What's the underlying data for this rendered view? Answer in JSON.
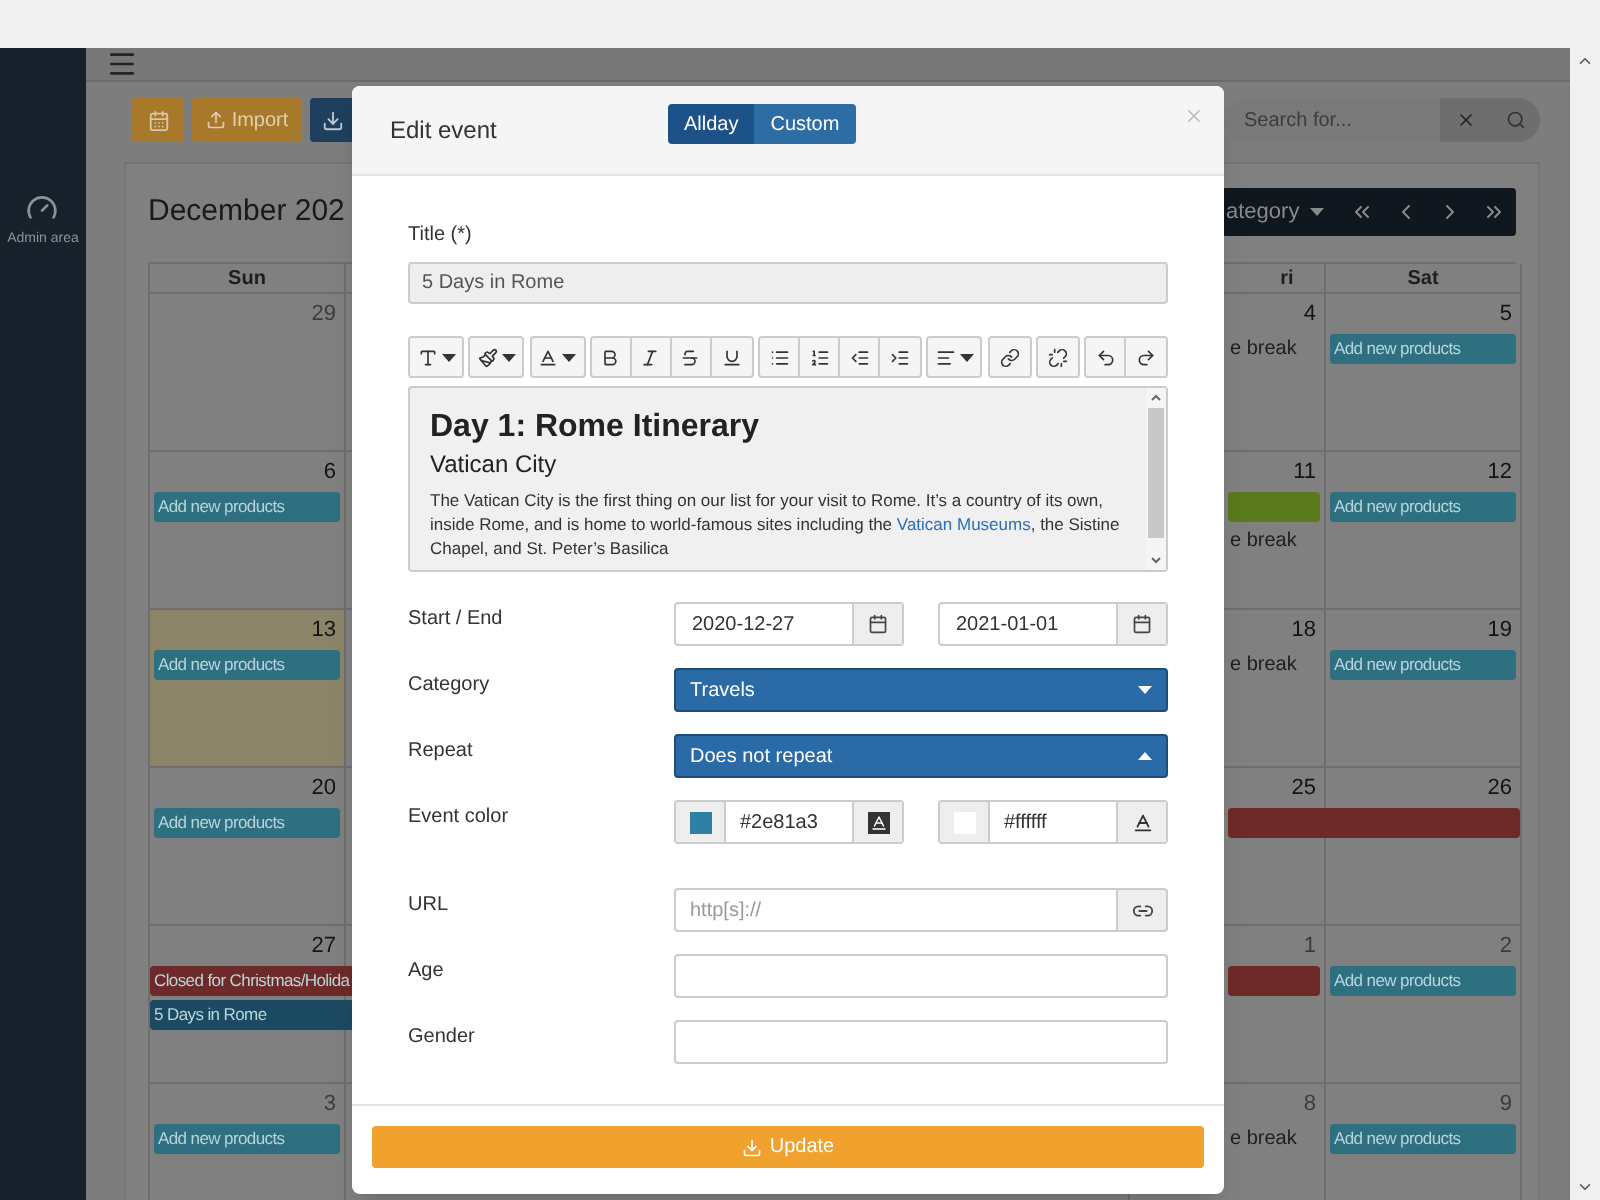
{
  "sidebar": {
    "items": [
      {
        "label": "Admin area"
      }
    ]
  },
  "toolbar": {
    "import_label": "Import"
  },
  "search": {
    "placeholder": "Search for..."
  },
  "calendar": {
    "title": "December 202",
    "filter_label": "ategory",
    "columns": [
      {
        "label": "Sun"
      },
      {
        "label": "ri"
      },
      {
        "label": "Sat"
      }
    ],
    "rows": [
      {
        "cells": [
          {
            "day": "29",
            "muted": true,
            "today": false
          },
          {
            "day": "4",
            "muted": false,
            "today": false,
            "events": [
              {
                "kind": "text",
                "title": "e break"
              }
            ]
          },
          {
            "day": "5",
            "muted": false,
            "today": false,
            "events": [
              {
                "kind": "bar",
                "title": "Add new products",
                "color": "#2e6f80",
                "continues": false
              }
            ]
          }
        ]
      },
      {
        "cells": [
          {
            "day": "6",
            "muted": false,
            "today": false,
            "events": [
              {
                "kind": "bar",
                "title": "Add new products",
                "color": "#2e6f80",
                "continues": false
              }
            ]
          },
          {
            "day": "11",
            "muted": false,
            "today": false,
            "events": [
              {
                "kind": "bar",
                "color": "#5a7a1c",
                "continues": false
              },
              {
                "kind": "text",
                "title": "e break"
              }
            ]
          },
          {
            "day": "12",
            "muted": false,
            "today": false,
            "events": [
              {
                "kind": "bar",
                "title": "Add new products",
                "color": "#2e6f80",
                "continues": false
              }
            ]
          }
        ]
      },
      {
        "cells": [
          {
            "day": "13",
            "muted": false,
            "today": true,
            "events": [
              {
                "kind": "bar",
                "title": "Add new products",
                "color": "#2e6f80",
                "continues": false
              }
            ]
          },
          {
            "day": "18",
            "muted": false,
            "today": false,
            "events": [
              {
                "kind": "text",
                "title": "e break"
              }
            ]
          },
          {
            "day": "19",
            "muted": false,
            "today": false,
            "events": [
              {
                "kind": "bar",
                "title": "Add new products",
                "color": "#2e6f80",
                "continues": false
              }
            ]
          }
        ]
      },
      {
        "cells": [
          {
            "day": "20",
            "muted": false,
            "today": false,
            "events": [
              {
                "kind": "bar",
                "title": "Add new products",
                "color": "#2e6f80",
                "continues": false
              }
            ]
          },
          {
            "day": "25",
            "muted": false,
            "today": false,
            "events": [
              {
                "kind": "bar",
                "color": "#6e2a28",
                "continues": true
              }
            ]
          },
          {
            "day": "26",
            "muted": false,
            "today": false
          }
        ]
      },
      {
        "cells": [
          {
            "day": "27",
            "muted": false,
            "today": false,
            "events": [
              {
                "kind": "bar",
                "title": "Closed for Christmas/Holida",
                "color": "#6e2a28",
                "continues": true
              },
              {
                "kind": "bar",
                "title": "5 Days in Rome",
                "color": "#1d4a63",
                "continues": true
              }
            ]
          },
          {
            "day": "1",
            "muted": true,
            "today": false,
            "events": [
              {
                "kind": "bar",
                "color": "#6e2a28",
                "continues": false
              }
            ]
          },
          {
            "day": "2",
            "muted": true,
            "today": false,
            "events": [
              {
                "kind": "bar",
                "title": "Add new products",
                "color": "#2e6f80",
                "continues": false
              }
            ]
          }
        ]
      },
      {
        "cells": [
          {
            "day": "3",
            "muted": true,
            "today": false,
            "events": [
              {
                "kind": "bar",
                "title": "Add new products",
                "color": "#2e6f80",
                "continues": false
              }
            ]
          },
          {
            "day": "8",
            "muted": true,
            "today": false,
            "events": [
              {
                "kind": "text",
                "title": "e break"
              }
            ]
          },
          {
            "day": "9",
            "muted": true,
            "today": false,
            "events": [
              {
                "kind": "bar",
                "title": "Add new products",
                "color": "#2e6f80",
                "continues": false
              }
            ]
          }
        ]
      }
    ]
  },
  "modal": {
    "title": "Edit event",
    "mode_toggle": [
      {
        "label": "Allday",
        "selected": true
      },
      {
        "label": "Custom",
        "selected": false
      }
    ],
    "title_field": {
      "label": "Title (*)",
      "value": "5 Days in Rome"
    },
    "editor": {
      "heading": "Day 1: Rome Itinerary",
      "subheading": "Vatican City",
      "paragraph": "The Vatican City is the first thing on our list for your visit to Rome. It’s a country of its own, inside Rome, and is home to world-famous sites including the ",
      "link": "Vatican Museums",
      "paragraph_end": ", the Sistine Chapel, and St. Peter’s Basilica"
    },
    "rows": [
      {
        "kind": "dates",
        "label": "Start / End",
        "start": "2020-12-27",
        "end": "2021-01-01"
      },
      {
        "kind": "select",
        "label": "Category",
        "value": "Travels",
        "expanded": false
      },
      {
        "kind": "select",
        "label": "Repeat",
        "value": "Does not repeat",
        "expanded": true
      },
      {
        "kind": "colors",
        "label": "Event color",
        "colors": [
          {
            "value": "#2e81a3",
            "color": "#2e81a3"
          },
          {
            "value": "#ffffff",
            "color": "#ffffff"
          }
        ]
      },
      {
        "kind": "url",
        "label": "URL",
        "placeholder": "http[s]://"
      },
      {
        "kind": "input",
        "label": "Age"
      },
      {
        "kind": "input",
        "label": "Gender"
      }
    ],
    "update_label": "Update"
  }
}
